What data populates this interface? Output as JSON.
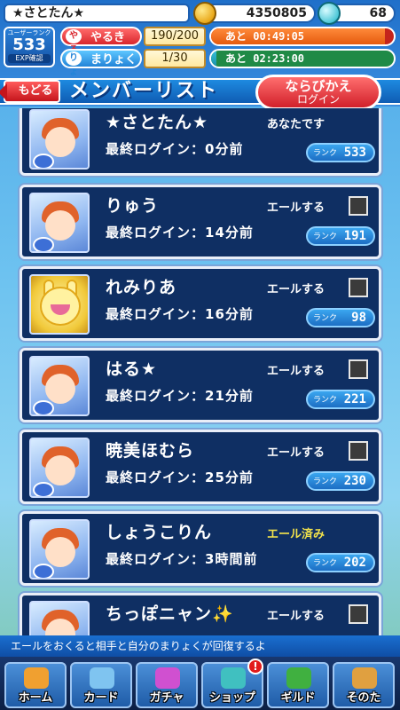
{
  "header": {
    "player_name": "★さとたん★",
    "coins": "4350805",
    "gems": "68",
    "rank_label": "ユーザーランク",
    "rank_value": "533",
    "exp_button": "EXP確認",
    "stamina": {
      "label": "やるき",
      "icon": "やる",
      "value": "190/200",
      "timer": "あと 00:49:05",
      "fill_percent": 95
    },
    "magic": {
      "label": "まりょく",
      "icon": "りょ",
      "value": "1/30",
      "timer": "あと 02:23:00",
      "fill_percent": 3
    }
  },
  "title_bar": {
    "back_label": "もどる",
    "title": "メンバーリスト",
    "sort_line1": "ならびかえ",
    "sort_line2": "ログイン"
  },
  "members": [
    {
      "name": "★さとたん★",
      "login": "最終ログイン：0分前",
      "status": "あなたです",
      "checkbox": false,
      "rank_label": "ランク",
      "rank": "533",
      "avatar": "arle"
    },
    {
      "name": "りゅう",
      "login": "最終ログイン：14分前",
      "status": "エールする",
      "checkbox": true,
      "rank_label": "ランク",
      "rank": "191",
      "avatar": "arle"
    },
    {
      "name": "れみりあ",
      "login": "最終ログイン：16分前",
      "status": "エールする",
      "checkbox": true,
      "rank_label": "ランク",
      "rank": "98",
      "avatar": "carbuncle"
    },
    {
      "name": "はる★",
      "login": "最終ログイン：21分前",
      "status": "エールする",
      "checkbox": true,
      "rank_label": "ランク",
      "rank": "221",
      "avatar": "arle"
    },
    {
      "name": "暁美ほむら",
      "login": "最終ログイン：25分前",
      "status": "エールする",
      "checkbox": true,
      "rank_label": "ランク",
      "rank": "230",
      "avatar": "arle"
    },
    {
      "name": "しょうこりん",
      "login": "最終ログイン：3時間前",
      "status": "エール済み",
      "checkbox": false,
      "rank_label": "ランク",
      "rank": "202",
      "avatar": "arle"
    },
    {
      "name": "ちっぽニャン✨",
      "login": "",
      "status": "エールする",
      "checkbox": true,
      "rank_label": "",
      "rank": "",
      "avatar": "arle"
    }
  ],
  "hint": "エールをおくると相手と自分のまりょくが回復するよ",
  "tabs": [
    {
      "label": "ホーム",
      "icon": "home-icon",
      "color": "#f0a030"
    },
    {
      "label": "カード",
      "icon": "card-icon",
      "color": "#7fc4f0"
    },
    {
      "label": "ガチャ",
      "icon": "gacha-icon",
      "color": "#d050d0"
    },
    {
      "label": "ショップ",
      "icon": "shop-icon",
      "color": "#40c0c0",
      "badge": "!"
    },
    {
      "label": "ギルド",
      "icon": "guild-icon",
      "color": "#40b040"
    },
    {
      "label": "そのた",
      "icon": "other-icon",
      "color": "#e0a040"
    }
  ]
}
